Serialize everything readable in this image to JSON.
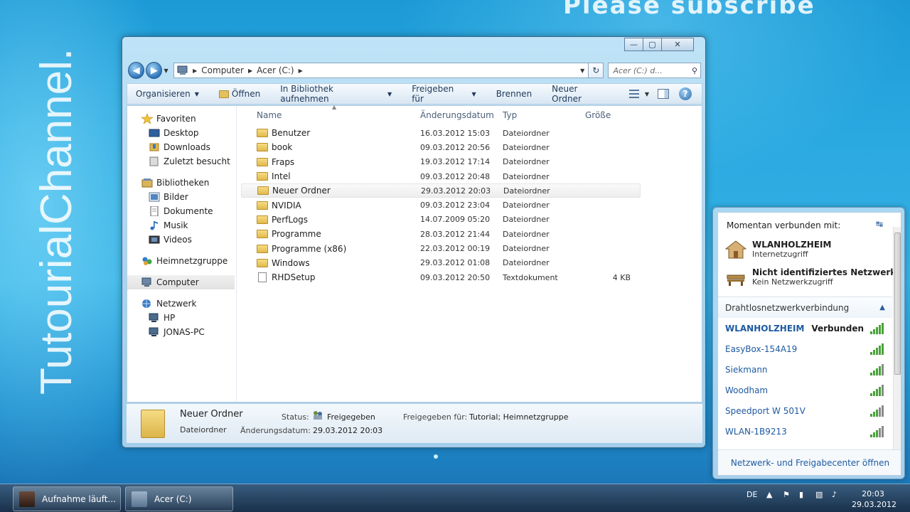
{
  "desktop": {
    "watermark_top": "Please subscribe",
    "watermark_side": "TutourialChannel."
  },
  "window": {
    "caption": {
      "minimize": "—",
      "maximize": "▢",
      "close": "✕"
    },
    "address": {
      "crumbs": [
        "Computer",
        "Acer (C:)"
      ]
    },
    "search": {
      "placeholder": "Acer (C:) d..."
    },
    "commands": [
      "Organisieren",
      "Öffnen",
      "In Bibliothek aufnehmen",
      "Freigeben für",
      "Brennen",
      "Neuer Ordner"
    ],
    "nav": {
      "favorites": "Favoriten",
      "favorites_items": [
        "Desktop",
        "Downloads",
        "Zuletzt besucht"
      ],
      "libraries": "Bibliotheken",
      "libraries_items": [
        "Bilder",
        "Dokumente",
        "Musik",
        "Videos"
      ],
      "homegroup": "Heimnetzgruppe",
      "computer": "Computer",
      "network": "Netzwerk",
      "network_items": [
        "HP",
        "JONAS-PC"
      ]
    },
    "columns": {
      "name": "Name",
      "date": "Änderungsdatum",
      "type": "Typ",
      "size": "Größe"
    },
    "files": [
      {
        "name": "Benutzer",
        "date": "16.03.2012 15:03",
        "type": "Dateiordner",
        "size": ""
      },
      {
        "name": "book",
        "date": "09.03.2012 20:56",
        "type": "Dateiordner",
        "size": ""
      },
      {
        "name": "Fraps",
        "date": "19.03.2012 17:14",
        "type": "Dateiordner",
        "size": ""
      },
      {
        "name": "Intel",
        "date": "09.03.2012 20:48",
        "type": "Dateiordner",
        "size": ""
      },
      {
        "name": "Neuer Ordner",
        "date": "29.03.2012 20:03",
        "type": "Dateiordner",
        "size": ""
      },
      {
        "name": "NVIDIA",
        "date": "09.03.2012 23:04",
        "type": "Dateiordner",
        "size": ""
      },
      {
        "name": "PerfLogs",
        "date": "14.07.2009 05:20",
        "type": "Dateiordner",
        "size": ""
      },
      {
        "name": "Programme",
        "date": "28.03.2012 21:44",
        "type": "Dateiordner",
        "size": ""
      },
      {
        "name": "Programme (x86)",
        "date": "22.03.2012 00:19",
        "type": "Dateiordner",
        "size": ""
      },
      {
        "name": "Windows",
        "date": "29.03.2012 01:08",
        "type": "Dateiordner",
        "size": ""
      },
      {
        "name": "RHDSetup",
        "date": "09.03.2012 20:50",
        "type": "Textdokument",
        "size": "4 KB"
      }
    ],
    "details": {
      "name": "Neuer Ordner",
      "type": "Dateiordner",
      "status_label": "Status:",
      "status_value": "Freigegeben",
      "date_label": "Änderungsdatum:",
      "date_value": "29.03.2012 20:03",
      "shared_label": "Freigegeben für:",
      "shared_value": "Tutorial; Heimnetzgruppe"
    }
  },
  "flyout": {
    "header": "Momentan verbunden mit:",
    "connections": [
      {
        "name": "WLANHOLZHEIM",
        "sub": "Internetzugriff"
      },
      {
        "name": "Nicht identifiziertes Netzwerk",
        "sub": "Kein Netzwerkzugriff"
      }
    ],
    "section": "Drahtlosnetzwerkverbindung",
    "networks": [
      {
        "name": "WLANHOLZHEIM",
        "status": "Verbunden",
        "signal": 5
      },
      {
        "name": "EasyBox-154A19",
        "status": "",
        "signal": 5
      },
      {
        "name": "Siekmann",
        "status": "",
        "signal": 4
      },
      {
        "name": "Woodham",
        "status": "",
        "signal": 4
      },
      {
        "name": "Speedport W 501V",
        "status": "",
        "signal": 3
      },
      {
        "name": "WLAN-1B9213",
        "status": "",
        "signal": 3
      }
    ],
    "footer": "Netzwerk- und Freigabecenter öffnen"
  },
  "taskbar": {
    "buttons": [
      "Aufnahme läuft...",
      "Acer (C:)"
    ],
    "language": "DE",
    "time": "20:03",
    "date": "29.03.2012"
  }
}
